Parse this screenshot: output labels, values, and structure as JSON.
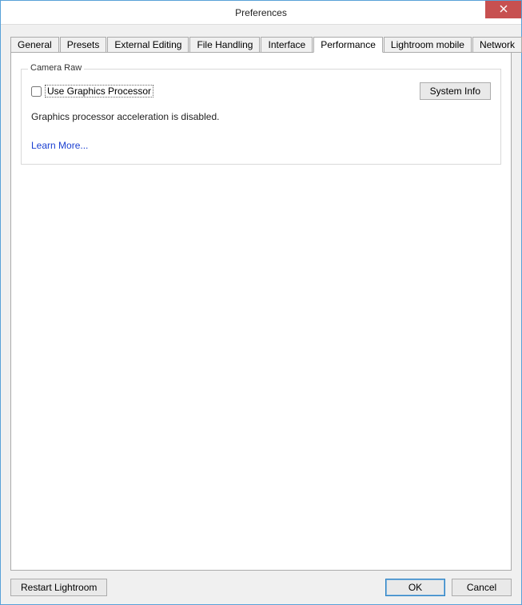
{
  "window": {
    "title": "Preferences"
  },
  "tabs": {
    "general": "General",
    "presets": "Presets",
    "external_editing": "External Editing",
    "file_handling": "File Handling",
    "interface": "Interface",
    "performance": "Performance",
    "lightroom_mobile": "Lightroom mobile",
    "network": "Network",
    "active": "performance"
  },
  "group": {
    "legend": "Camera Raw",
    "checkbox_label": "Use Graphics Processor",
    "checkbox_checked": false,
    "system_info_btn": "System Info",
    "status_text": "Graphics processor acceleration is disabled.",
    "learn_more": "Learn More..."
  },
  "footer": {
    "restart": "Restart Lightroom",
    "ok": "OK",
    "cancel": "Cancel"
  }
}
